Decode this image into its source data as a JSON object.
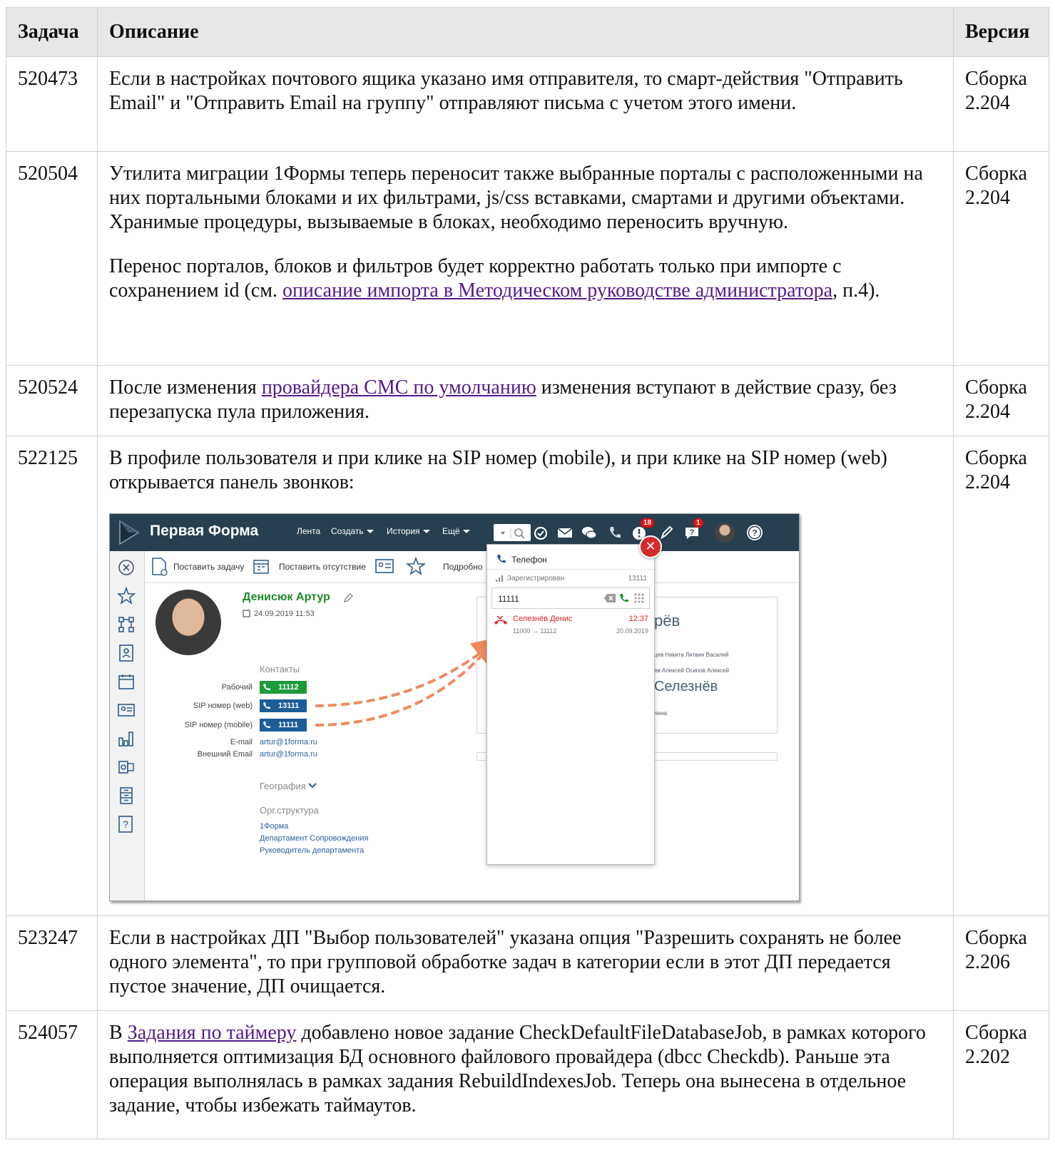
{
  "headers": {
    "task": "Задача",
    "description": "Описание",
    "version": "Версия"
  },
  "rows": [
    {
      "id": "520473",
      "version": "Сборка 2.204",
      "text": "Если в настройках почтового ящика указано имя отправителя, то смарт-действия \"Отправить Email\" и \"Отправить Email на группу\" отправляют письма с учетом этого имени."
    },
    {
      "id": "520504",
      "version": "Сборка 2.204",
      "p1": "Утилита миграции 1Формы теперь переносит также выбранные порталы с расположенными на них портальными блоками и их фильтрами, js/css вставками, смартами и другими объектами. Хранимые процедуры, вызываемые в блоках, необходимо переносить вручную.",
      "p2_before": "Перенос порталов, блоков и фильтров будет корректно работать только при импорте с сохранением id (см. ",
      "p2_link": "описание импорта в Методическом руководстве администратора",
      "p2_after": ", п.4)."
    },
    {
      "id": "520524",
      "version": "Сборка 2.204",
      "before": "После изменения ",
      "link": "провайдера СМС по умолчанию",
      "after": " изменения вступают в действие сразу, без перезапуска пула приложения."
    },
    {
      "id": "522125",
      "version": "Сборка 2.204",
      "text": "В профиле пользователя и при клике на SIP номер (mobile), и при клике на SIP номер (web) открывается панель звонков:"
    },
    {
      "id": "523247",
      "version": "Сборка 2.206",
      "text": "Если в настройках ДП \"Выбор пользователей\" указана опция \"Разрешить сохранять не более одного элемента\", то при групповой обработке задач в категории если в этот ДП передается пустое значение, ДП очищается."
    },
    {
      "id": "524057",
      "version": "Сборка 2.202",
      "before": "В ",
      "link": "Задания по таймеру",
      "after": " добавлено новое задание CheckDefaultFileDatabaseJob, в рамках которого выполняется оптимизация БД основного файлового провайдера (dbcc Checkdb). Раньше эта операция выполнялась в рамках задания RebuildIndexesJob. Теперь она вынесена в отдельное задание, чтобы избежать таймаутов."
    }
  ],
  "screenshot": {
    "brand": "Первая Форма",
    "nav": [
      "Лента",
      "Создать",
      "История",
      "Ещё"
    ],
    "badges": {
      "alerts": "18",
      "questions": "1"
    },
    "toolbar": {
      "task": "Поставить задачу",
      "absence": "Поставить отсутствие",
      "more": "Подробно"
    },
    "profile": {
      "name": "Денисюк Артур",
      "date": "24.09.2019 11:53",
      "contacts_title": "Контакты",
      "work_label": "Рабочий",
      "work_value": "11112",
      "sip_web_label": "SIP номер (web)",
      "sip_web_value": "13111",
      "sip_mobile_label": "SIP номер (mobile)",
      "sip_mobile_value": "11111",
      "email_label": "E-mail",
      "email_value": "artur@1forma.ru",
      "ext_email_label": "Внешний Email",
      "ext_email_value": "artur@1forma.ru",
      "geo": "География",
      "org_title": "Орг.структура",
      "org": [
        "1Форма",
        "Департамент Сопровождения",
        "Руководитель департамента"
      ]
    },
    "background": {
      "big1": "рёв",
      "small1": "цев Никита Литвин Василий",
      "small2": "ев Алексей Осипов Алексей",
      "big2": "Селезнёв",
      "small3": "лена"
    },
    "phone": {
      "title": "Телефон",
      "status": "Зарегистрирован",
      "status_num": "13111",
      "input": "11111",
      "call_name": "Селезнёв Денис",
      "call_time": "12:37",
      "call_route": "11000 → 11112",
      "call_date": "20.09.2019"
    },
    "colors": {
      "topbar": "#273f4f",
      "green": "#1d9a3a",
      "blue": "#1d5c99",
      "arrow": "#ef8a5f",
      "missed": "#e02020"
    }
  }
}
